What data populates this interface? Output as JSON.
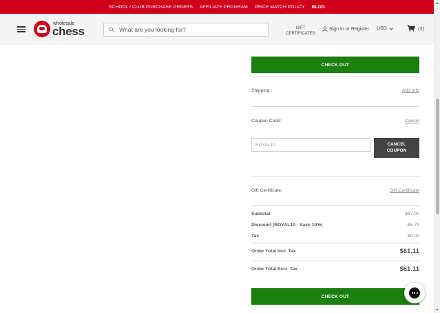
{
  "promo": {
    "links": [
      "SCHOOL / CLUB PURCHASE ORDERS",
      "AFFILIATE PROGRAM",
      "PRICE MATCH POLICY",
      "BLOG"
    ],
    "color": "#d0021b"
  },
  "header": {
    "logo_small": "wholesale",
    "logo_big": "chess",
    "search_placeholder": "What are you looking for?",
    "gift_certificates": "GIFT CERTIFICATES",
    "signin": "Sign In or Register",
    "currency": "USD",
    "cart_count": "(2)"
  },
  "summary": {
    "checkout_label": "CHECK OUT",
    "shipping_label": "Shipping :",
    "shipping_link": "Add Info",
    "coupon_label": "Coupon Code:",
    "coupon_cancel_link": "Cancel",
    "coupon_value": "ROYAL10",
    "cancel_coupon_button": "CANCEL COUPON",
    "gift_label": "Gift Certificate:",
    "gift_link": "Gift Certificate",
    "subtotal_label": "Subtotal",
    "subtotal_value": "$67.90",
    "discount_label": "Discount (ROYAL10 - Save 10%)",
    "discount_value": "-$6.79",
    "tax_label": "Tax",
    "tax_value": "$0.00",
    "total_incl_label": "Order Total Incl. Tax",
    "total_incl_value": "$61.11",
    "total_excl_label": "Order Total Excl. Tax",
    "total_excl_value": "$61.11",
    "accent_green": "#1a7f0e"
  },
  "icons": {
    "menu": "hamburger-icon",
    "search": "search-icon",
    "user": "user-icon",
    "currency_dropdown": "chevron-down-icon",
    "cart": "cart-icon",
    "chat": "chat-icon"
  }
}
